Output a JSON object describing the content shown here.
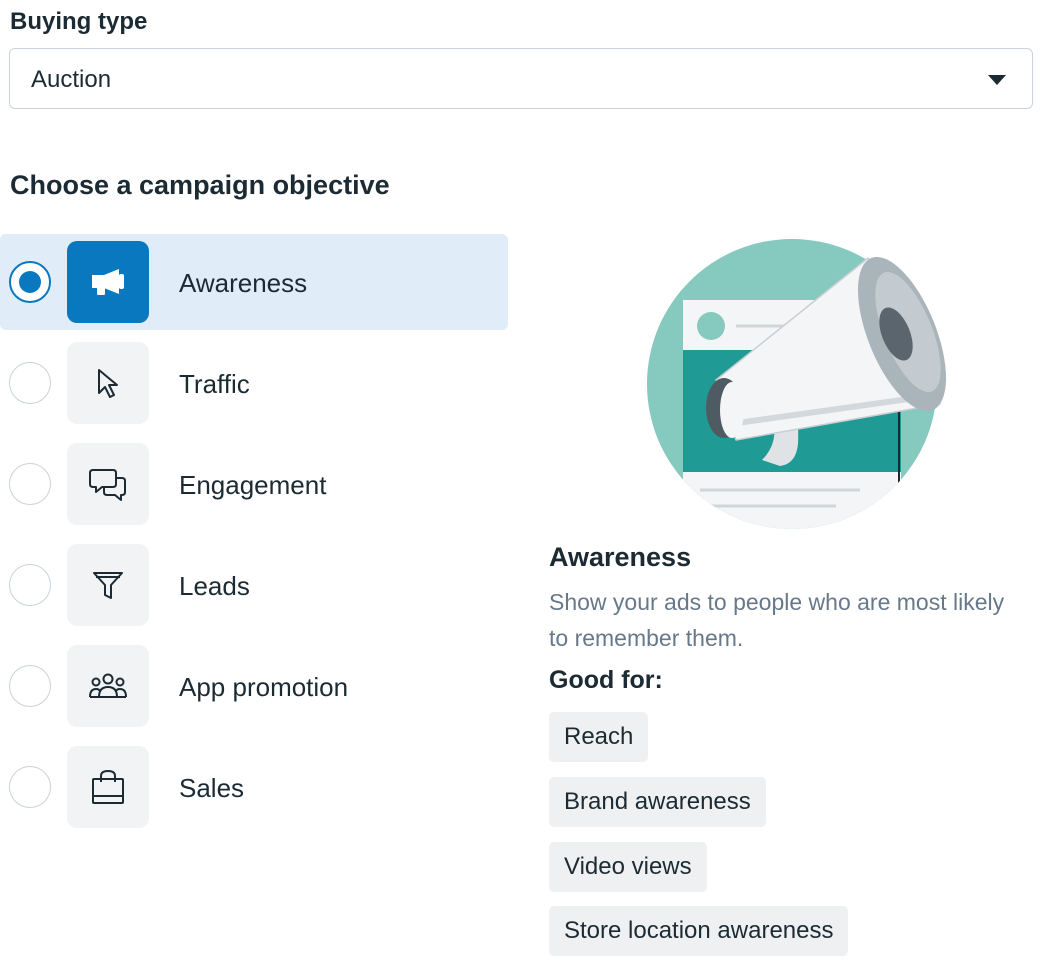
{
  "buying_type": {
    "label": "Buying type",
    "selected": "Auction"
  },
  "objective_section": {
    "title": "Choose a campaign objective",
    "selected": "Awareness",
    "options": [
      {
        "label": "Awareness",
        "icon": "megaphone-icon",
        "selected": true
      },
      {
        "label": "Traffic",
        "icon": "cursor-icon",
        "selected": false
      },
      {
        "label": "Engagement",
        "icon": "chat-bubbles-icon",
        "selected": false
      },
      {
        "label": "Leads",
        "icon": "funnel-icon",
        "selected": false
      },
      {
        "label": "App promotion",
        "icon": "people-group-icon",
        "selected": false
      },
      {
        "label": "Sales",
        "icon": "shopping-bag-icon",
        "selected": false
      }
    ]
  },
  "detail": {
    "illustration": "megaphone-illustration",
    "title": "Awareness",
    "description": "Show your ads to people who are most likely to remember them.",
    "good_for_label": "Good for:",
    "good_for_tags": [
      "Reach",
      "Brand awareness",
      "Video views",
      "Store location awareness"
    ]
  },
  "colors": {
    "accent": "#0a78be",
    "selected_row_bg": "#e0ecf7",
    "tile_bg": "#f1f3f4",
    "text": "#1c2b33",
    "muted_text": "#67788a",
    "tag_bg": "#eef0f2",
    "illustration_teal": "#85c9bf",
    "illustration_dark_teal": "#1f9a94"
  }
}
